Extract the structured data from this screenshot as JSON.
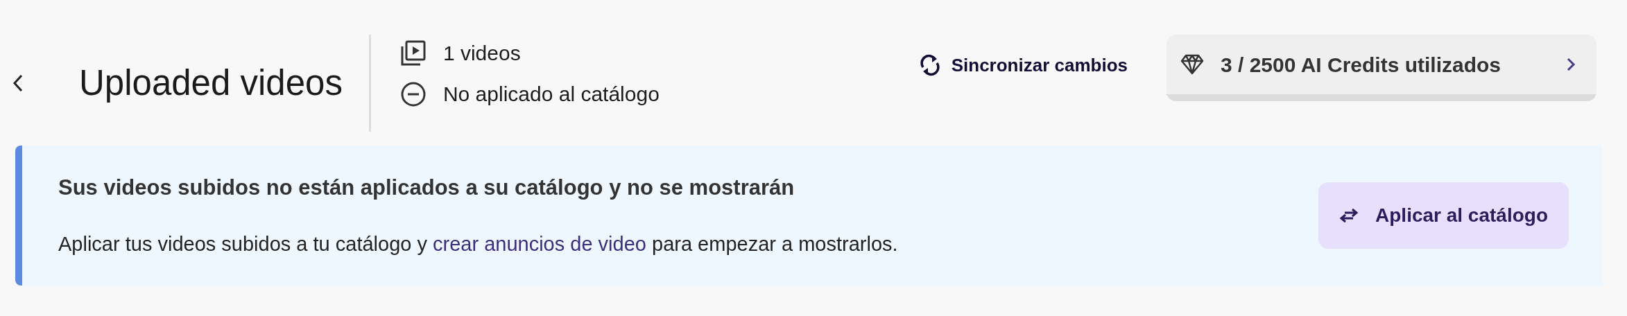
{
  "header": {
    "title": "Uploaded videos",
    "video_count": "1 videos",
    "catalog_status": "No aplicado al catálogo",
    "sync_button": "Sincronizar cambios",
    "credits": {
      "text": "3 / 2500 AI Credits utilizados",
      "level": 0.0012
    }
  },
  "banner": {
    "heading": "Sus videos subidos no están aplicados a su catálogo y no se mostrarán",
    "text_before": "Aplicar tus videos subidos a tu catálogo y ",
    "link": "crear anuncios de video",
    "text_after": " para empezar a mostrarlos.",
    "button": "Aplicar al catálogo"
  }
}
